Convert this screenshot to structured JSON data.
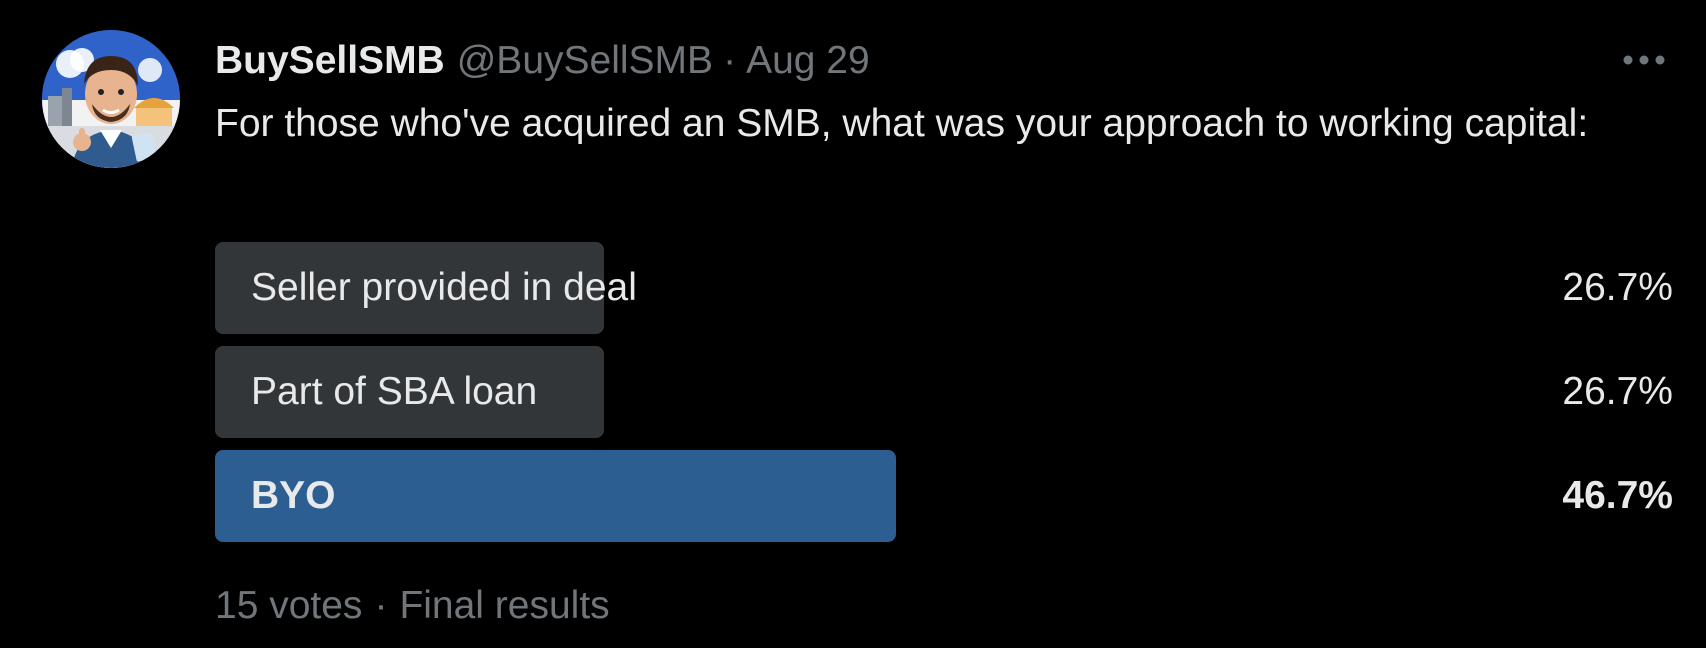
{
  "tweet": {
    "display_name": "BuySellSMB",
    "handle": "@BuySellSMB",
    "separator": "·",
    "date": "Aug 29",
    "more_icon": "more-horizontal-icon",
    "text": "For those who've acquired an SMB, what was your approach to working capital:"
  },
  "poll": {
    "options": [
      {
        "label": "Seller provided in deal",
        "percent_text": "26.7%",
        "percent": 26.7,
        "winner": false
      },
      {
        "label": "Part of SBA loan",
        "percent_text": "26.7%",
        "percent": 26.7,
        "winner": false
      },
      {
        "label": "BYO",
        "percent_text": "46.7%",
        "percent": 46.7,
        "winner": true
      }
    ],
    "votes": "15 votes",
    "separator": "·",
    "status": "Final results"
  },
  "colors": {
    "background": "#000000",
    "text_primary": "#e7e9ea",
    "text_secondary": "#71767b",
    "poll_bar": "#333639",
    "poll_bar_winner": "#2c5e92"
  }
}
